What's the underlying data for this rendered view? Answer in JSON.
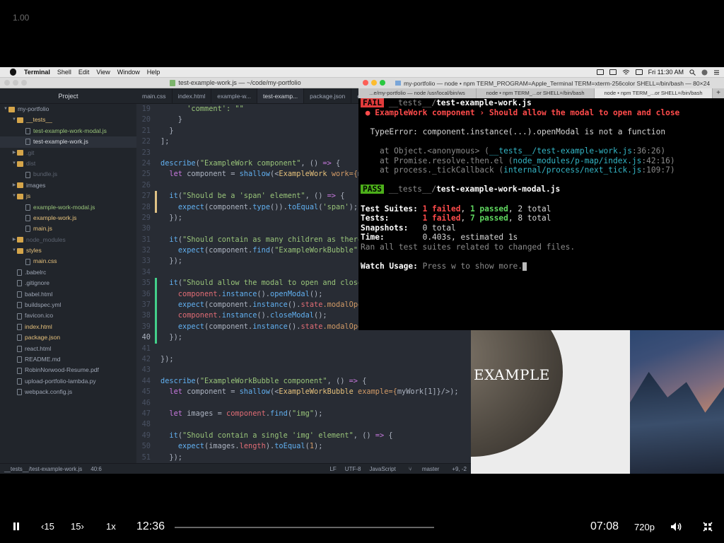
{
  "video": {
    "speed_overlay": "1.00",
    "current_time": "12:36",
    "duration": "07:08",
    "playback_rate": "1x",
    "skip_back_label": "15",
    "skip_forward_label": "15",
    "quality": "720p",
    "progress": 0.0
  },
  "menubar": {
    "app_name": "Terminal",
    "items": [
      "Shell",
      "Edit",
      "View",
      "Window",
      "Help"
    ],
    "clock": "Fri 11:30 AM"
  },
  "editor": {
    "title": "test-example-work.js — ~/code/my-portfolio",
    "tree_header": "Project",
    "tabs": [
      "main.css",
      "index.html",
      "example-w...",
      "test-examp...",
      "package.json",
      "ex"
    ],
    "tree": [
      {
        "label": "my-portfolio",
        "kind": "folder-open",
        "depth": 0,
        "state": ""
      },
      {
        "label": "__tests__",
        "kind": "folder-open",
        "depth": 1,
        "state": "add"
      },
      {
        "label": "test-example-work-modal.js",
        "kind": "file",
        "depth": 2,
        "state": "mod"
      },
      {
        "label": "test-example-work.js",
        "kind": "file",
        "depth": 2,
        "state": "sel"
      },
      {
        "label": ".git",
        "kind": "folder",
        "depth": 1,
        "state": "dim"
      },
      {
        "label": "dist",
        "kind": "folder-open",
        "depth": 1,
        "state": "dim"
      },
      {
        "label": "bundle.js",
        "kind": "file",
        "depth": 2,
        "state": "dim"
      },
      {
        "label": "images",
        "kind": "folder",
        "depth": 1,
        "state": ""
      },
      {
        "label": "js",
        "kind": "folder-open",
        "depth": 1,
        "state": "add"
      },
      {
        "label": "example-work-modal.js",
        "kind": "file",
        "depth": 2,
        "state": "mod"
      },
      {
        "label": "example-work.js",
        "kind": "file",
        "depth": 2,
        "state": "add"
      },
      {
        "label": "main.js",
        "kind": "file",
        "depth": 2,
        "state": "add"
      },
      {
        "label": "node_modules",
        "kind": "folder",
        "depth": 1,
        "state": "dim"
      },
      {
        "label": "styles",
        "kind": "folder-open",
        "depth": 1,
        "state": "add"
      },
      {
        "label": "main.css",
        "kind": "file",
        "depth": 2,
        "state": "add"
      },
      {
        "label": ".babelrc",
        "kind": "file",
        "depth": 1,
        "state": ""
      },
      {
        "label": ".gitignore",
        "kind": "file",
        "depth": 1,
        "state": ""
      },
      {
        "label": "babel.html",
        "kind": "file",
        "depth": 1,
        "state": ""
      },
      {
        "label": "buildspec.yml",
        "kind": "file",
        "depth": 1,
        "state": ""
      },
      {
        "label": "favicon.ico",
        "kind": "file",
        "depth": 1,
        "state": ""
      },
      {
        "label": "index.html",
        "kind": "file",
        "depth": 1,
        "state": "add"
      },
      {
        "label": "package.json",
        "kind": "file",
        "depth": 1,
        "state": "add"
      },
      {
        "label": "react.html",
        "kind": "file",
        "depth": 1,
        "state": ""
      },
      {
        "label": "README.md",
        "kind": "file",
        "depth": 1,
        "state": ""
      },
      {
        "label": "RobinNorwood-Resume.pdf",
        "kind": "file",
        "depth": 1,
        "state": ""
      },
      {
        "label": "upload-portfolio-lambda.py",
        "kind": "file",
        "depth": 1,
        "state": ""
      },
      {
        "label": "webpack.config.js",
        "kind": "file",
        "depth": 1,
        "state": ""
      }
    ],
    "code_lines": [
      {
        "n": "19",
        "g": "",
        "t": [
          [
            "      'comment': \"\"",
            "#98c379"
          ]
        ]
      },
      {
        "n": "20",
        "g": "",
        "t": [
          [
            "    }",
            "#abb2bf"
          ]
        ]
      },
      {
        "n": "21",
        "g": "",
        "t": [
          [
            "  }",
            "#abb2bf"
          ]
        ]
      },
      {
        "n": "22",
        "g": "",
        "t": [
          [
            "];",
            "#abb2bf"
          ]
        ]
      },
      {
        "n": "23",
        "g": "",
        "t": [
          [
            "",
            "#abb2bf"
          ]
        ]
      },
      {
        "n": "24",
        "g": "",
        "t": [
          [
            "describe",
            "#61afef"
          ],
          [
            "(",
            "#abb2bf"
          ],
          [
            "\"ExampleWork component\"",
            "#98c379"
          ],
          [
            ", () ",
            "#abb2bf"
          ],
          [
            "=>",
            "#c678dd"
          ],
          [
            " {",
            "#abb2bf"
          ]
        ]
      },
      {
        "n": "25",
        "g": "",
        "t": [
          [
            "  ",
            "#abb2bf"
          ],
          [
            "let",
            "#c678dd"
          ],
          [
            " component = ",
            "#abb2bf"
          ],
          [
            "shallow",
            "#61afef"
          ],
          [
            "(<",
            "#abb2bf"
          ],
          [
            "ExampleWork",
            "#e5c07b"
          ],
          [
            " work={",
            "#d19a66"
          ],
          [
            "m",
            "#abb2bf"
          ]
        ]
      },
      {
        "n": "26",
        "g": "",
        "t": [
          [
            "",
            "#abb2bf"
          ]
        ]
      },
      {
        "n": "27",
        "g": "mod",
        "t": [
          [
            "  ",
            "#abb2bf"
          ],
          [
            "it",
            "#61afef"
          ],
          [
            "(",
            "#abb2bf"
          ],
          [
            "\"Should be a 'span' element\"",
            "#98c379"
          ],
          [
            ", () ",
            "#abb2bf"
          ],
          [
            "=>",
            "#c678dd"
          ],
          [
            " {",
            "#abb2bf"
          ]
        ]
      },
      {
        "n": "28",
        "g": "mod",
        "t": [
          [
            "    ",
            "#abb2bf"
          ],
          [
            "expect",
            "#61afef"
          ],
          [
            "(component.",
            "#abb2bf"
          ],
          [
            "type",
            "#61afef"
          ],
          [
            "()).",
            "#abb2bf"
          ],
          [
            "toEqual",
            "#61afef"
          ],
          [
            "(",
            "#abb2bf"
          ],
          [
            "'span'",
            "#98c379"
          ],
          [
            ");",
            "#abb2bf"
          ]
        ]
      },
      {
        "n": "29",
        "g": "",
        "t": [
          [
            "  });",
            "#abb2bf"
          ]
        ]
      },
      {
        "n": "30",
        "g": "",
        "t": [
          [
            "",
            "#abb2bf"
          ]
        ]
      },
      {
        "n": "31",
        "g": "",
        "t": [
          [
            "  ",
            "#abb2bf"
          ],
          [
            "it",
            "#61afef"
          ],
          [
            "(",
            "#abb2bf"
          ],
          [
            "\"Should contain as many children as there",
            "#98c379"
          ]
        ]
      },
      {
        "n": "32",
        "g": "",
        "t": [
          [
            "    ",
            "#abb2bf"
          ],
          [
            "expect",
            "#61afef"
          ],
          [
            "(component.",
            "#abb2bf"
          ],
          [
            "find",
            "#61afef"
          ],
          [
            "(",
            "#abb2bf"
          ],
          [
            "\"ExampleWorkBubble\"",
            "#98c379"
          ],
          [
            ")",
            "#abb2bf"
          ]
        ]
      },
      {
        "n": "33",
        "g": "",
        "t": [
          [
            "  });",
            "#abb2bf"
          ]
        ]
      },
      {
        "n": "34",
        "g": "",
        "t": [
          [
            "",
            "#abb2bf"
          ]
        ]
      },
      {
        "n": "35",
        "g": "add",
        "t": [
          [
            "  ",
            "#abb2bf"
          ],
          [
            "it",
            "#61afef"
          ],
          [
            "(",
            "#abb2bf"
          ],
          [
            "\"Should allow the modal to open and close",
            "#98c379"
          ]
        ]
      },
      {
        "n": "36",
        "g": "add",
        "t": [
          [
            "    component.",
            "#e06c75"
          ],
          [
            "instance",
            "#61afef"
          ],
          [
            "().",
            "#abb2bf"
          ],
          [
            "openModal",
            "#61afef"
          ],
          [
            "();",
            "#abb2bf"
          ]
        ]
      },
      {
        "n": "37",
        "g": "add",
        "t": [
          [
            "    ",
            "#abb2bf"
          ],
          [
            "expect",
            "#61afef"
          ],
          [
            "(component.",
            "#abb2bf"
          ],
          [
            "instance",
            "#61afef"
          ],
          [
            "().",
            "#abb2bf"
          ],
          [
            "state",
            "#e06c75"
          ],
          [
            ".modalOpe",
            "#d19a66"
          ]
        ]
      },
      {
        "n": "38",
        "g": "add",
        "t": [
          [
            "    component.",
            "#e06c75"
          ],
          [
            "instance",
            "#61afef"
          ],
          [
            "().",
            "#abb2bf"
          ],
          [
            "closeModal",
            "#61afef"
          ],
          [
            "();",
            "#abb2bf"
          ]
        ]
      },
      {
        "n": "39",
        "g": "add",
        "t": [
          [
            "    ",
            "#abb2bf"
          ],
          [
            "expect",
            "#61afef"
          ],
          [
            "(component.",
            "#abb2bf"
          ],
          [
            "instance",
            "#61afef"
          ],
          [
            "().",
            "#abb2bf"
          ],
          [
            "state",
            "#e06c75"
          ],
          [
            ".modalOpe",
            "#d19a66"
          ]
        ]
      },
      {
        "n": "40",
        "g": "add",
        "t": [
          [
            "  });",
            "#abb2bf"
          ]
        ]
      },
      {
        "n": "41",
        "g": "",
        "t": [
          [
            "",
            "#abb2bf"
          ]
        ]
      },
      {
        "n": "42",
        "g": "",
        "t": [
          [
            "});",
            "#abb2bf"
          ]
        ]
      },
      {
        "n": "43",
        "g": "",
        "t": [
          [
            "",
            "#abb2bf"
          ]
        ]
      },
      {
        "n": "44",
        "g": "",
        "t": [
          [
            "describe",
            "#61afef"
          ],
          [
            "(",
            "#abb2bf"
          ],
          [
            "\"ExampleWorkBubble component\"",
            "#98c379"
          ],
          [
            ", () ",
            "#abb2bf"
          ],
          [
            "=>",
            "#c678dd"
          ],
          [
            " {",
            "#abb2bf"
          ]
        ]
      },
      {
        "n": "45",
        "g": "",
        "t": [
          [
            "  ",
            "#abb2bf"
          ],
          [
            "let",
            "#c678dd"
          ],
          [
            " component = ",
            "#abb2bf"
          ],
          [
            "shallow",
            "#61afef"
          ],
          [
            "(<",
            "#abb2bf"
          ],
          [
            "ExampleWorkBubble",
            "#e5c07b"
          ],
          [
            " example={",
            "#d19a66"
          ],
          [
            "myWork[1]",
            "#abb2bf"
          ],
          [
            "}/>);",
            "#abb2bf"
          ]
        ]
      },
      {
        "n": "46",
        "g": "",
        "t": [
          [
            "",
            "#abb2bf"
          ]
        ]
      },
      {
        "n": "47",
        "g": "",
        "t": [
          [
            "  ",
            "#abb2bf"
          ],
          [
            "let",
            "#c678dd"
          ],
          [
            " images = ",
            "#abb2bf"
          ],
          [
            "component",
            "#e06c75"
          ],
          [
            ".",
            "#abb2bf"
          ],
          [
            "find",
            "#61afef"
          ],
          [
            "(",
            "#abb2bf"
          ],
          [
            "\"img\"",
            "#98c379"
          ],
          [
            ");",
            "#abb2bf"
          ]
        ]
      },
      {
        "n": "48",
        "g": "",
        "t": [
          [
            "",
            "#abb2bf"
          ]
        ]
      },
      {
        "n": "49",
        "g": "",
        "t": [
          [
            "  ",
            "#abb2bf"
          ],
          [
            "it",
            "#61afef"
          ],
          [
            "(",
            "#abb2bf"
          ],
          [
            "\"Should contain a single 'img' element\"",
            "#98c379"
          ],
          [
            ", () ",
            "#abb2bf"
          ],
          [
            "=>",
            "#c678dd"
          ],
          [
            " {",
            "#abb2bf"
          ]
        ]
      },
      {
        "n": "50",
        "g": "",
        "t": [
          [
            "    ",
            "#abb2bf"
          ],
          [
            "expect",
            "#61afef"
          ],
          [
            "(images.",
            "#abb2bf"
          ],
          [
            "length",
            "#e06c75"
          ],
          [
            ").",
            "#abb2bf"
          ],
          [
            "toEqual",
            "#61afef"
          ],
          [
            "(",
            "#abb2bf"
          ],
          [
            "1",
            "#d19a66"
          ],
          [
            ");",
            "#abb2bf"
          ]
        ]
      },
      {
        "n": "51",
        "g": "",
        "t": [
          [
            "  });",
            "#abb2bf"
          ]
        ]
      }
    ],
    "status": {
      "file": "__tests__/test-example-work.js",
      "cursor": "40:6",
      "line_ending": "LF",
      "encoding": "UTF-8",
      "grammar": "JavaScript",
      "branch": "master",
      "diff": "+9, -2"
    },
    "current_line": "40"
  },
  "terminal": {
    "title": "my-portfolio — node • npm TERM_PROGRAM=Apple_Terminal TERM=xterm-256color SHELL=/bin/bash — 80×24",
    "tabs": [
      "...e/my-portfolio — node /usr/local/bin/ws",
      "node • npm TERM_...or SHELL=/bin/bash",
      "node • npm TERM_...or SHELL=/bin/bash"
    ],
    "fail_badge": "FAIL",
    "fail_dir": "__tests__/",
    "fail_file": "test-example-work.js",
    "fail_bullet": "● ExampleWork component › Should allow the modal to open and close",
    "type_error": "TypeError: component.instance(...).openModal is not a function",
    "stack": [
      {
        "at": "at Object.<anonymous> (",
        "path": "__tests__/test-example-work.js",
        "pos": ":36:26)"
      },
      {
        "at": "at Promise.resolve.then.el (",
        "path": "node_modules/p-map/index.js",
        "pos": ":42:16)"
      },
      {
        "at": "at process._tickCallback (",
        "path": "internal/process/next_tick.js",
        "pos": ":109:7)"
      }
    ],
    "pass_badge": "PASS",
    "pass_dir": "__tests__/",
    "pass_file": "test-example-work-modal.js",
    "suites_label": "Test Suites:",
    "suites_failed": "1 failed",
    "suites_passed": "1 passed",
    "suites_total": "2 total",
    "tests_label": "Tests:",
    "tests_failed": "1 failed",
    "tests_passed": "7 passed",
    "tests_total": "8 total",
    "snapshots_label": "Snapshots:",
    "snapshots_value": "0 total",
    "time_label": "Time:",
    "time_value": "0.403s, estimated 1s",
    "ran_all": "Ran all test suites related to changed files.",
    "watch_label": "Watch Usage:",
    "watch_text": "Press w to show more."
  },
  "preview": {
    "heading": "EXAMPLE"
  },
  "colors": {
    "fail_badge_bg": "#e23b3b",
    "pass_badge_bg": "#4caf1a",
    "accent_green": "#43d08a",
    "editor_bg": "#282c34"
  }
}
